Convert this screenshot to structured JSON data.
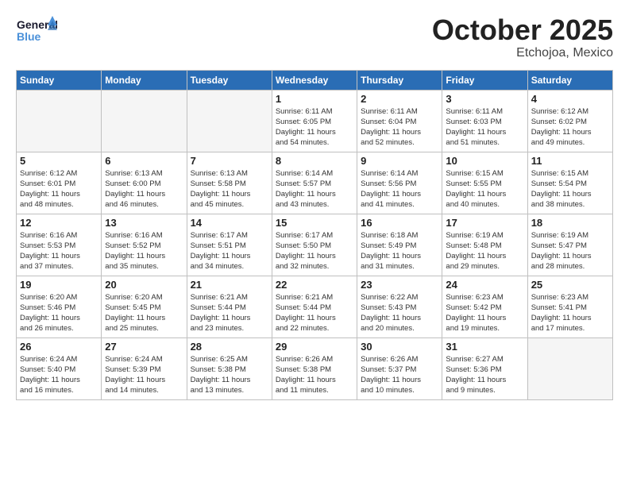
{
  "logo": {
    "line1": "General",
    "line2": "Blue"
  },
  "title": {
    "month": "October 2025",
    "location": "Etchojoa, Mexico"
  },
  "weekdays": [
    "Sunday",
    "Monday",
    "Tuesday",
    "Wednesday",
    "Thursday",
    "Friday",
    "Saturday"
  ],
  "weeks": [
    [
      {
        "day": "",
        "content": ""
      },
      {
        "day": "",
        "content": ""
      },
      {
        "day": "",
        "content": ""
      },
      {
        "day": "1",
        "content": "Sunrise: 6:11 AM\nSunset: 6:05 PM\nDaylight: 11 hours\nand 54 minutes."
      },
      {
        "day": "2",
        "content": "Sunrise: 6:11 AM\nSunset: 6:04 PM\nDaylight: 11 hours\nand 52 minutes."
      },
      {
        "day": "3",
        "content": "Sunrise: 6:11 AM\nSunset: 6:03 PM\nDaylight: 11 hours\nand 51 minutes."
      },
      {
        "day": "4",
        "content": "Sunrise: 6:12 AM\nSunset: 6:02 PM\nDaylight: 11 hours\nand 49 minutes."
      }
    ],
    [
      {
        "day": "5",
        "content": "Sunrise: 6:12 AM\nSunset: 6:01 PM\nDaylight: 11 hours\nand 48 minutes."
      },
      {
        "day": "6",
        "content": "Sunrise: 6:13 AM\nSunset: 6:00 PM\nDaylight: 11 hours\nand 46 minutes."
      },
      {
        "day": "7",
        "content": "Sunrise: 6:13 AM\nSunset: 5:58 PM\nDaylight: 11 hours\nand 45 minutes."
      },
      {
        "day": "8",
        "content": "Sunrise: 6:14 AM\nSunset: 5:57 PM\nDaylight: 11 hours\nand 43 minutes."
      },
      {
        "day": "9",
        "content": "Sunrise: 6:14 AM\nSunset: 5:56 PM\nDaylight: 11 hours\nand 41 minutes."
      },
      {
        "day": "10",
        "content": "Sunrise: 6:15 AM\nSunset: 5:55 PM\nDaylight: 11 hours\nand 40 minutes."
      },
      {
        "day": "11",
        "content": "Sunrise: 6:15 AM\nSunset: 5:54 PM\nDaylight: 11 hours\nand 38 minutes."
      }
    ],
    [
      {
        "day": "12",
        "content": "Sunrise: 6:16 AM\nSunset: 5:53 PM\nDaylight: 11 hours\nand 37 minutes."
      },
      {
        "day": "13",
        "content": "Sunrise: 6:16 AM\nSunset: 5:52 PM\nDaylight: 11 hours\nand 35 minutes."
      },
      {
        "day": "14",
        "content": "Sunrise: 6:17 AM\nSunset: 5:51 PM\nDaylight: 11 hours\nand 34 minutes."
      },
      {
        "day": "15",
        "content": "Sunrise: 6:17 AM\nSunset: 5:50 PM\nDaylight: 11 hours\nand 32 minutes."
      },
      {
        "day": "16",
        "content": "Sunrise: 6:18 AM\nSunset: 5:49 PM\nDaylight: 11 hours\nand 31 minutes."
      },
      {
        "day": "17",
        "content": "Sunrise: 6:19 AM\nSunset: 5:48 PM\nDaylight: 11 hours\nand 29 minutes."
      },
      {
        "day": "18",
        "content": "Sunrise: 6:19 AM\nSunset: 5:47 PM\nDaylight: 11 hours\nand 28 minutes."
      }
    ],
    [
      {
        "day": "19",
        "content": "Sunrise: 6:20 AM\nSunset: 5:46 PM\nDaylight: 11 hours\nand 26 minutes."
      },
      {
        "day": "20",
        "content": "Sunrise: 6:20 AM\nSunset: 5:45 PM\nDaylight: 11 hours\nand 25 minutes."
      },
      {
        "day": "21",
        "content": "Sunrise: 6:21 AM\nSunset: 5:44 PM\nDaylight: 11 hours\nand 23 minutes."
      },
      {
        "day": "22",
        "content": "Sunrise: 6:21 AM\nSunset: 5:44 PM\nDaylight: 11 hours\nand 22 minutes."
      },
      {
        "day": "23",
        "content": "Sunrise: 6:22 AM\nSunset: 5:43 PM\nDaylight: 11 hours\nand 20 minutes."
      },
      {
        "day": "24",
        "content": "Sunrise: 6:23 AM\nSunset: 5:42 PM\nDaylight: 11 hours\nand 19 minutes."
      },
      {
        "day": "25",
        "content": "Sunrise: 6:23 AM\nSunset: 5:41 PM\nDaylight: 11 hours\nand 17 minutes."
      }
    ],
    [
      {
        "day": "26",
        "content": "Sunrise: 6:24 AM\nSunset: 5:40 PM\nDaylight: 11 hours\nand 16 minutes."
      },
      {
        "day": "27",
        "content": "Sunrise: 6:24 AM\nSunset: 5:39 PM\nDaylight: 11 hours\nand 14 minutes."
      },
      {
        "day": "28",
        "content": "Sunrise: 6:25 AM\nSunset: 5:38 PM\nDaylight: 11 hours\nand 13 minutes."
      },
      {
        "day": "29",
        "content": "Sunrise: 6:26 AM\nSunset: 5:38 PM\nDaylight: 11 hours\nand 11 minutes."
      },
      {
        "day": "30",
        "content": "Sunrise: 6:26 AM\nSunset: 5:37 PM\nDaylight: 11 hours\nand 10 minutes."
      },
      {
        "day": "31",
        "content": "Sunrise: 6:27 AM\nSunset: 5:36 PM\nDaylight: 11 hours\nand 9 minutes."
      },
      {
        "day": "",
        "content": ""
      }
    ]
  ]
}
